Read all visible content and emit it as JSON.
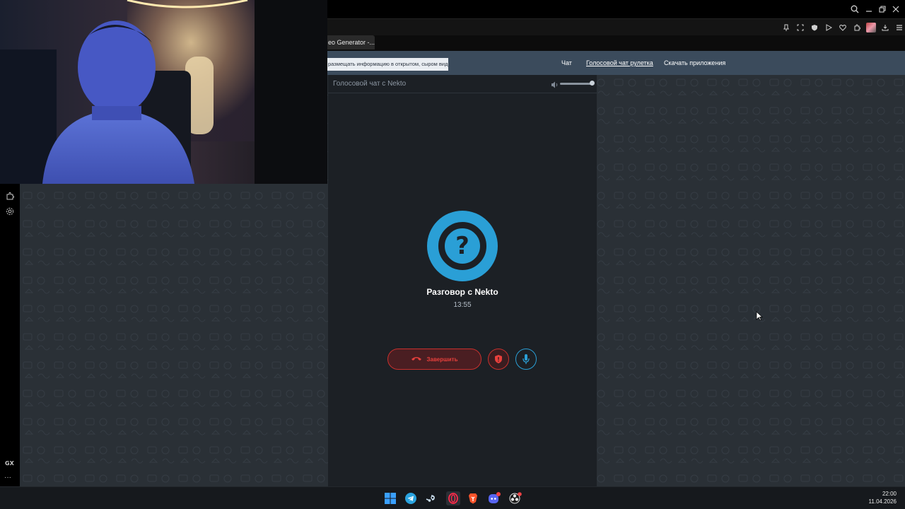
{
  "browser": {
    "tab_title": "eo Generator -...",
    "sidebar_badge": "GX",
    "sidebar_more": "···"
  },
  "site": {
    "warning_banner": "размещать информацию в открытом, сыром виде!",
    "nav": [
      {
        "label": "Чат",
        "active": false
      },
      {
        "label": "Голосовой чат рулетка",
        "active": true
      },
      {
        "label": "Скачать приложения",
        "active": false
      }
    ]
  },
  "call_panel": {
    "title": "Голосовой чат с Nekto",
    "volume_fraction": 1.0,
    "avatar_glyph": "?",
    "peer_name": "Разговор с Nekto",
    "elapsed": "13:55",
    "end_label": "Завершить"
  },
  "taskbar": {
    "time": "22:00",
    "date": "11.04.2026",
    "discord_badge": "9+",
    "apps": [
      "windows-start-icon",
      "telegram-icon",
      "steam-icon",
      "opera-gx-icon",
      "brave-icon",
      "discord-icon",
      "obs-icon"
    ]
  },
  "colors": {
    "accent_blue": "#2a9fd6",
    "danger_red": "#c8302d",
    "header_bg": "#3b4b5c",
    "panel_bg": "#1c2025"
  }
}
